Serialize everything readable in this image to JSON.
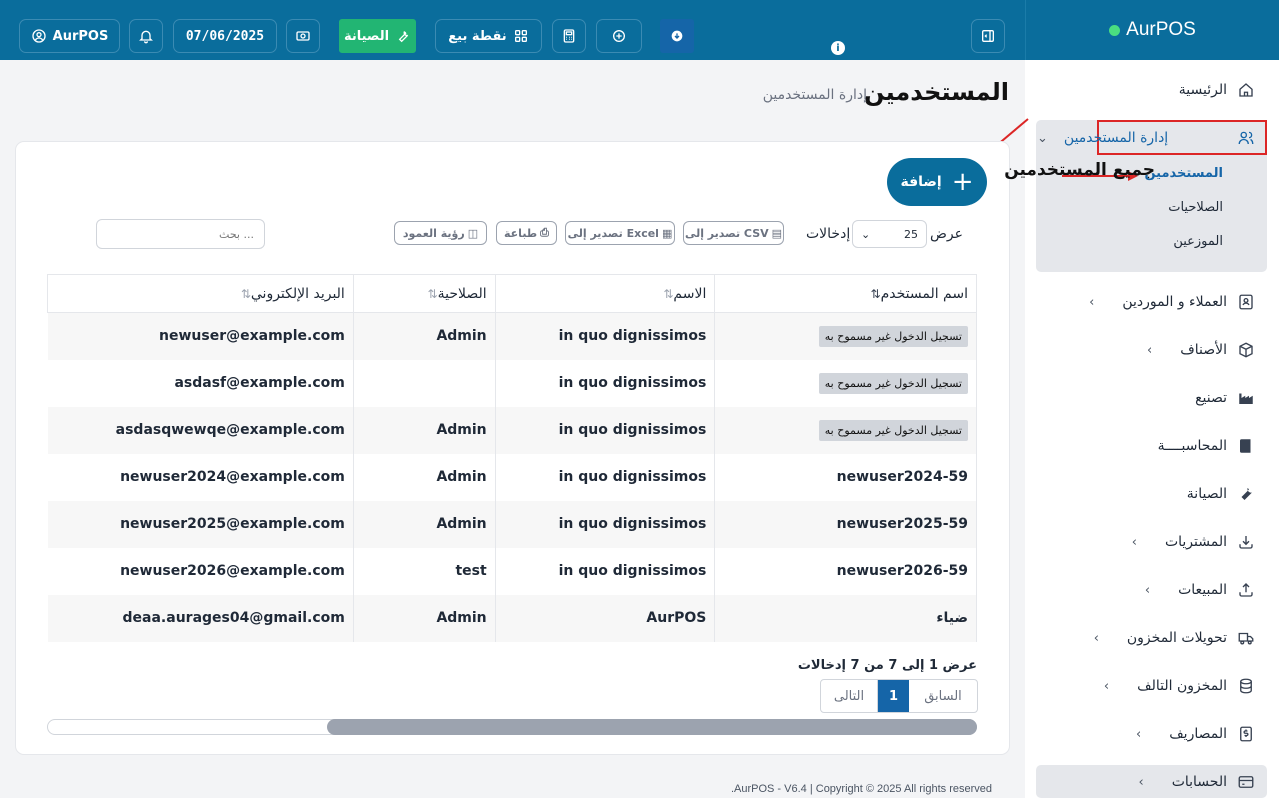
{
  "topbar": {
    "user_label": "AurPOS",
    "date": "07/06/2025",
    "maintenance_label": "الصيانة",
    "pos_label": "نقطة بيع"
  },
  "brand": {
    "name": "AurPOS"
  },
  "sidebar": {
    "items": [
      {
        "label": "الرئيسية",
        "icon": "home-icon"
      },
      {
        "label": "إدارة المستخدمين",
        "icon": "users-icon"
      },
      {
        "label": "العملاء و الموردين",
        "icon": "contacts-icon"
      },
      {
        "label": "الأصناف",
        "icon": "box-icon"
      },
      {
        "label": "تصنيع",
        "icon": "factory-icon"
      },
      {
        "label": "المحاسبــــة",
        "icon": "book-icon"
      },
      {
        "label": "الصيانة",
        "icon": "wrench-icon"
      },
      {
        "label": "المشتريات",
        "icon": "download-icon"
      },
      {
        "label": "المبيعات",
        "icon": "upload-icon"
      },
      {
        "label": "تحويلات المخزون",
        "icon": "truck-icon"
      },
      {
        "label": "المخزون التالف",
        "icon": "database-icon"
      },
      {
        "label": "المصاريف",
        "icon": "dollar-icon"
      },
      {
        "label": "الحسابات",
        "icon": "card-icon"
      }
    ],
    "sub_items": [
      "المستخدمين",
      "الصلاحيات",
      "الموزعين"
    ]
  },
  "header": {
    "title": "المستخدمين",
    "breadcrumb": "إدارة المستخدمين"
  },
  "card": {
    "title": "جميع المستخدمين",
    "add_label": "إضافة",
    "show_label": "عرض",
    "entries_label": "إدخالات",
    "page_length": "25",
    "export_csv": "تصدير إلى CSV",
    "export_excel": "تصدير إلى Excel",
    "print": "طباعة",
    "column_visibility": "رؤية العمود",
    "search_placeholder": "بحث ..."
  },
  "table": {
    "headers": [
      "اسم المستخدم",
      "الاسم",
      "الصلاحية",
      "البريد الإلكتروني"
    ],
    "rows": [
      {
        "user": "تسجيل الدخول غير مسموح به",
        "user_badge": true,
        "name": "in quo dignissimos",
        "role": "Admin",
        "email": "newuser@example.com"
      },
      {
        "user": "تسجيل الدخول غير مسموح به",
        "user_badge": true,
        "name": "in quo dignissimos",
        "role": "",
        "email": "asdasf@example.com"
      },
      {
        "user": "تسجيل الدخول غير مسموح به",
        "user_badge": true,
        "name": "in quo dignissimos",
        "role": "Admin",
        "email": "asdasqwewqe@example.com"
      },
      {
        "user": "newuser2024-59",
        "user_badge": false,
        "name": "in quo dignissimos",
        "role": "Admin",
        "email": "newuser2024@example.com"
      },
      {
        "user": "newuser2025-59",
        "user_badge": false,
        "name": "in quo dignissimos",
        "role": "Admin",
        "email": "newuser2025@example.com"
      },
      {
        "user": "newuser2026-59",
        "user_badge": false,
        "name": "in quo dignissimos",
        "role": "test",
        "email": "newuser2026@example.com"
      },
      {
        "user": "ضياء",
        "user_badge": false,
        "name": "AurPOS",
        "role": "Admin",
        "email": "deaa.aurages04@gmail.com"
      }
    ]
  },
  "pagination": {
    "info": "عرض 1 إلى 7 من 7 إدخالات",
    "prev": "السابق",
    "current": "1",
    "next": "التالى"
  },
  "footer": {
    "text": ".AurPOS - V6.4 | Copyright © 2025 All rights reserved"
  },
  "colors": {
    "primary": "#0a6d9c",
    "accent_green": "#22b573",
    "highlight_red": "#dc2626"
  }
}
